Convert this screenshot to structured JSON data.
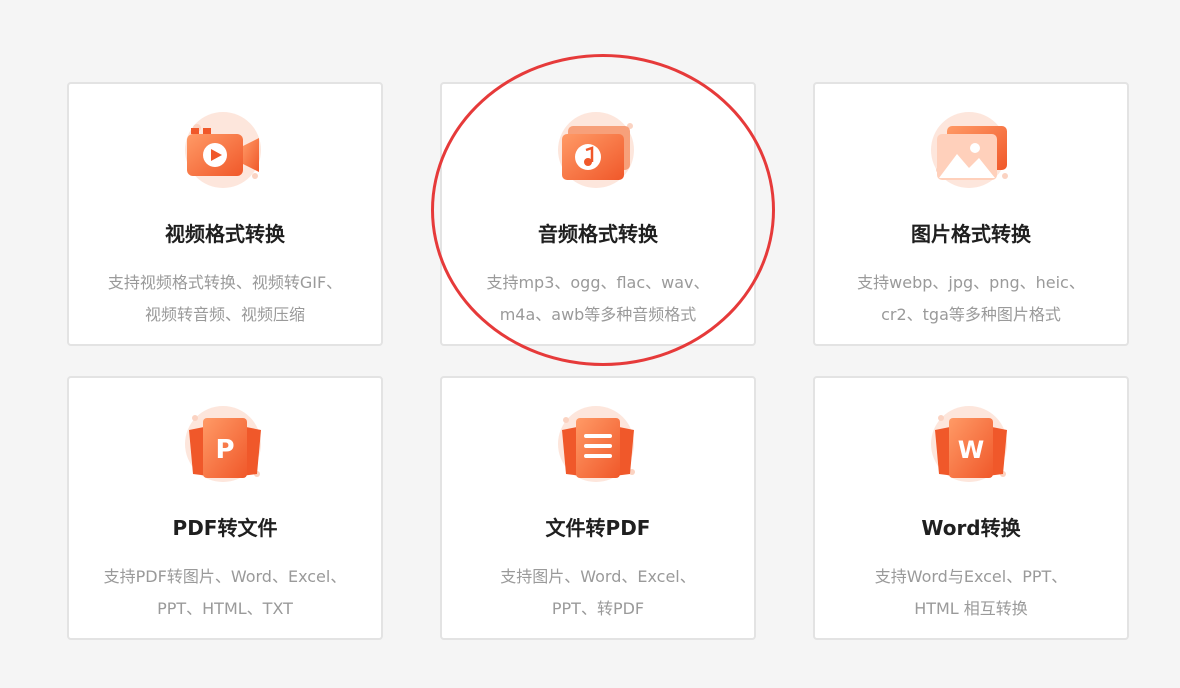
{
  "accent_color": "#f06a35",
  "highlight_color": "#e63a3a",
  "cards": [
    {
      "icon": "video-camera-icon",
      "title": "视频格式转换",
      "desc_line1": "支持视频格式转换、视频转GIF、",
      "desc_line2": "视频转音频、视频压缩"
    },
    {
      "icon": "music-note-icon",
      "title": "音频格式转换",
      "desc_line1": "支持mp3、ogg、flac、wav、",
      "desc_line2": "m4a、awb等多种音频格式"
    },
    {
      "icon": "image-icon",
      "title": "图片格式转换",
      "desc_line1": "支持webp、jpg、png、heic、",
      "desc_line2": "cr2、tga等多种图片格式"
    },
    {
      "icon": "pdf-document-icon",
      "title": "PDF转文件",
      "desc_line1": "支持PDF转图片、Word、Excel、",
      "desc_line2": "PPT、HTML、TXT"
    },
    {
      "icon": "text-document-icon",
      "title": "文件转PDF",
      "desc_line1": "支持图片、Word、Excel、",
      "desc_line2": "PPT、转PDF"
    },
    {
      "icon": "word-document-icon",
      "title": "Word转换",
      "desc_line1": "支持Word与Excel、PPT、",
      "desc_line2": "HTML 相互转换"
    }
  ]
}
